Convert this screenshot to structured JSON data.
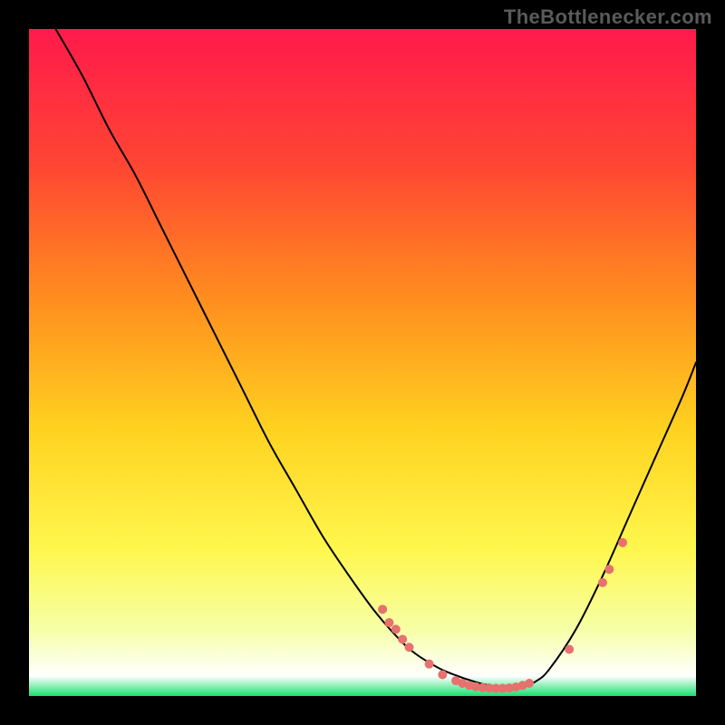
{
  "attribution": "TheBottlenecker.com",
  "chart_data": {
    "type": "line",
    "title": "",
    "xlabel": "",
    "ylabel": "",
    "xlim": [
      0,
      100
    ],
    "ylim": [
      0,
      100
    ],
    "grid": false,
    "legend": false,
    "background": {
      "kind": "vertical-gradient",
      "stops": [
        {
          "offset": 0.0,
          "color": "#ff1a4c"
        },
        {
          "offset": 0.2,
          "color": "#ff4433"
        },
        {
          "offset": 0.4,
          "color": "#ff8c1f"
        },
        {
          "offset": 0.6,
          "color": "#ffd21f"
        },
        {
          "offset": 0.78,
          "color": "#fff74d"
        },
        {
          "offset": 0.9,
          "color": "#f6ffa6"
        },
        {
          "offset": 0.97,
          "color": "#ffffff"
        },
        {
          "offset": 1.0,
          "color": "#18e06e"
        }
      ]
    },
    "curve": {
      "name": "bottleneck-curve",
      "color": "#000000",
      "stroke_width": 2,
      "x": [
        4,
        8,
        12,
        16,
        20,
        24,
        28,
        32,
        36,
        40,
        44,
        48,
        52,
        56,
        58,
        60,
        62,
        64,
        66,
        68,
        70,
        72,
        74,
        76,
        78,
        82,
        86,
        90,
        94,
        98,
        100
      ],
      "y": [
        100,
        93,
        85,
        78,
        70,
        62,
        54,
        46,
        38,
        31,
        24,
        18,
        12.5,
        8,
        6.3,
        5,
        3.9,
        3.1,
        2.4,
        1.8,
        1.4,
        1.2,
        1.3,
        2.2,
        4,
        10,
        18,
        27,
        36,
        45,
        50
      ]
    },
    "markers": {
      "color": "#e6716f",
      "radius": 5,
      "points": [
        {
          "x": 53,
          "y": 13
        },
        {
          "x": 54,
          "y": 11
        },
        {
          "x": 55,
          "y": 10
        },
        {
          "x": 56,
          "y": 8.5
        },
        {
          "x": 57,
          "y": 7.3
        },
        {
          "x": 60,
          "y": 4.8
        },
        {
          "x": 62,
          "y": 3.2
        },
        {
          "x": 64,
          "y": 2.3
        },
        {
          "x": 65,
          "y": 1.9
        },
        {
          "x": 66,
          "y": 1.6
        },
        {
          "x": 67,
          "y": 1.4
        },
        {
          "x": 68,
          "y": 1.25
        },
        {
          "x": 69,
          "y": 1.2
        },
        {
          "x": 70,
          "y": 1.15
        },
        {
          "x": 71,
          "y": 1.15
        },
        {
          "x": 72,
          "y": 1.2
        },
        {
          "x": 73,
          "y": 1.35
        },
        {
          "x": 74,
          "y": 1.6
        },
        {
          "x": 75,
          "y": 1.9
        },
        {
          "x": 81,
          "y": 7
        },
        {
          "x": 86,
          "y": 17
        },
        {
          "x": 87,
          "y": 19
        },
        {
          "x": 89,
          "y": 23
        }
      ]
    }
  }
}
